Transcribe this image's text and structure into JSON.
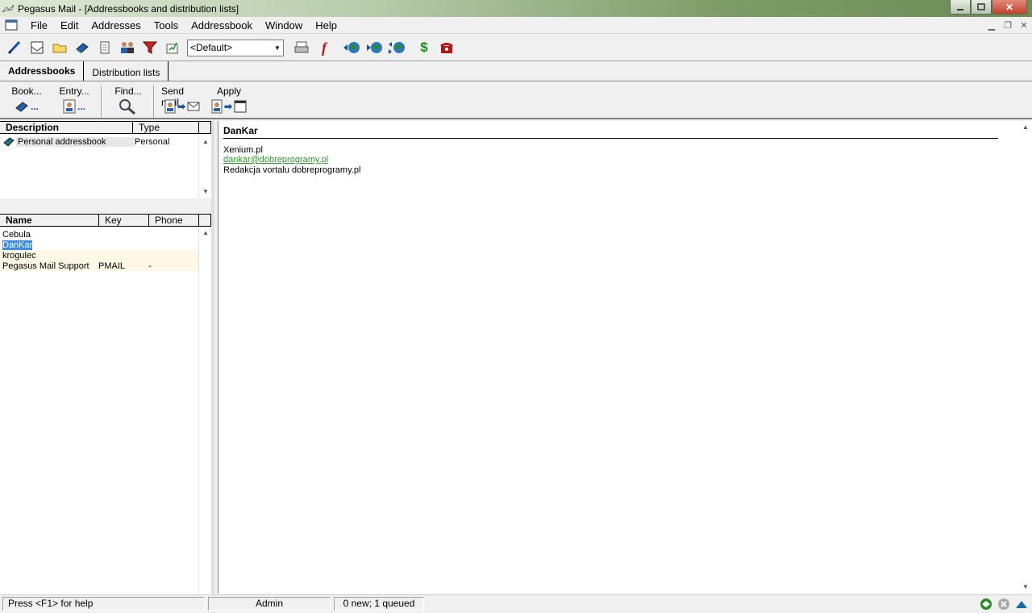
{
  "window": {
    "title": "Pegasus Mail - [Addressbooks and distribution lists]"
  },
  "menu": [
    "File",
    "Edit",
    "Addresses",
    "Tools",
    "Addressbook",
    "Window",
    "Help"
  ],
  "toolbar": {
    "identity_combo": "<Default>",
    "icons": [
      "compose-icon",
      "read-mail-icon",
      "folders-icon",
      "addressbook-icon",
      "notepad-icon",
      "network-addresses-icon",
      "filter-icon",
      "noticeboard-icon",
      "print-icon",
      "font-icon",
      "send-globe-icon",
      "receive-globe-icon",
      "send-receive-globe-icon",
      "dollar-icon",
      "phone-icon"
    ]
  },
  "tabs": {
    "addressbooks": "Addressbooks",
    "distribution_lists": "Distribution lists"
  },
  "actions": {
    "book": "Book...",
    "entry": "Entry...",
    "find": "Find...",
    "send_mail": "Send mail",
    "apply": "Apply"
  },
  "books": {
    "columns": {
      "description": "Description",
      "type": "Type"
    },
    "rows": [
      {
        "description": "Personal addressbook",
        "type": "Personal"
      }
    ]
  },
  "entries": {
    "columns": {
      "name": "Name",
      "key": "Key",
      "phone": "Phone"
    },
    "rows": [
      {
        "name": "Cebula",
        "key": "",
        "phone": ""
      },
      {
        "name": "DanKar",
        "key": "",
        "phone": ""
      },
      {
        "name": "krogulec",
        "key": "",
        "phone": ""
      },
      {
        "name": "Pegasus Mail Support",
        "key": "PMAIL",
        "phone": "-"
      }
    ]
  },
  "detail": {
    "title": "DanKar",
    "company": "Xenium.pl",
    "email": "dankar@dobreprogramy.pl",
    "notes": "Redakcja vortalu dobreprogramy.pl"
  },
  "status": {
    "help": "Press <F1> for help",
    "user": "Admin",
    "queue": "0 new; 1 queued"
  },
  "colors": {
    "link": "#2b9b2b",
    "selection": "#3a8ee6",
    "alt_row": "#fdf9e6"
  }
}
